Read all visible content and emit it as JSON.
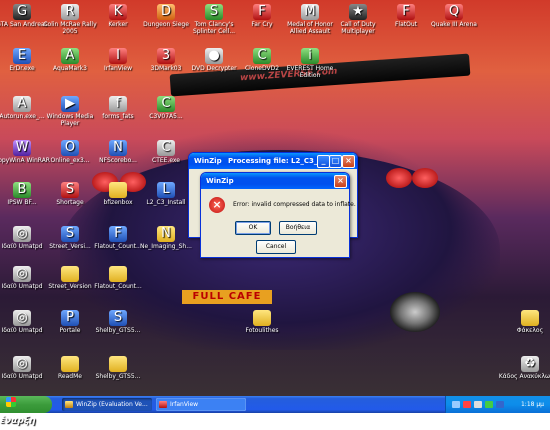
{
  "desktop": {
    "watermark": "www.ZEVERSE.com",
    "plate": "FULL CAFE",
    "icons": [
      {
        "label": "GTA San Andreas",
        "glyph": "G",
        "color": "ic-dark"
      },
      {
        "label": "Colin McRae Rally 2005",
        "glyph": "R",
        "color": "ic-grey"
      },
      {
        "label": "Kerker",
        "glyph": "K",
        "color": "ic-red"
      },
      {
        "label": "Dungeon Siege",
        "glyph": "D",
        "color": "ic-orange"
      },
      {
        "label": "Tom Clancy's Splinter Cell...",
        "glyph": "S",
        "color": "ic-green"
      },
      {
        "label": "Far Cry",
        "glyph": "F",
        "color": "ic-red"
      },
      {
        "label": "Medal of Honor Allied Assault",
        "glyph": "M",
        "color": "ic-grey"
      },
      {
        "label": "Call of Duty Multiplayer",
        "glyph": "★",
        "color": "ic-dark"
      },
      {
        "label": "FlatOut",
        "glyph": "F",
        "color": "ic-red"
      },
      {
        "label": "Quake III Arena",
        "glyph": "Q",
        "color": "ic-red"
      },
      {
        "label": "ErDr.exe",
        "glyph": "E",
        "color": "ic-blue"
      },
      {
        "label": "AquaMark3",
        "glyph": "A",
        "color": "ic-green"
      },
      {
        "label": "IrfanView",
        "glyph": "I",
        "color": "ic-red"
      },
      {
        "label": "3DMark03",
        "glyph": "3",
        "color": "ic-red"
      },
      {
        "label": "DVD Decrypter",
        "glyph": "●",
        "color": "ic-grey"
      },
      {
        "label": "CloneDVD2",
        "glyph": "C",
        "color": "ic-green"
      },
      {
        "label": "EVEREST Home Edition",
        "glyph": "i",
        "color": "ic-green"
      },
      {
        "label": "Autorun.exe_...",
        "glyph": "A",
        "color": "ic-grey"
      },
      {
        "label": "Windows Media Player",
        "glyph": "▶",
        "color": "ic-blue"
      },
      {
        "label": "forms_fats",
        "glyph": "f",
        "color": "ic-grey"
      },
      {
        "label": "C3V07A5...",
        "glyph": "C",
        "color": "ic-green"
      },
      {
        "label": "CopyWinA WinRAR",
        "glyph": "W",
        "color": "ic-purple"
      },
      {
        "label": "Online_ex3...",
        "glyph": "O",
        "color": "ic-blue"
      },
      {
        "label": "NFScorebo...",
        "glyph": "N",
        "color": "ic-blue"
      },
      {
        "label": "CTEE.exe",
        "glyph": "C",
        "color": "ic-grey"
      },
      {
        "label": "IPSW BF...",
        "glyph": "B",
        "color": "ic-green"
      },
      {
        "label": "Shortage",
        "glyph": "S",
        "color": "ic-red"
      },
      {
        "label": "bfizenbox",
        "glyph": "",
        "color": "ic-folder"
      },
      {
        "label": "L2_C3_Install",
        "glyph": "L",
        "color": "ic-blue"
      },
      {
        "label": "Ιδαί0 Umatpd",
        "glyph": "◎",
        "color": "ic-grey"
      },
      {
        "label": "Street_Versi...",
        "glyph": "S",
        "color": "ic-blue"
      },
      {
        "label": "Flatout_Count...",
        "glyph": "F",
        "color": "ic-blue"
      },
      {
        "label": "Ne_Imaging_Sh...",
        "glyph": "N",
        "color": "ic-folder"
      },
      {
        "label": "Ιδαί0 Umatpd",
        "glyph": "◎",
        "color": "ic-grey"
      },
      {
        "label": "Street_Version",
        "glyph": "",
        "color": "ic-folder"
      },
      {
        "label": "Flatout_Count...",
        "glyph": "",
        "color": "ic-folder"
      },
      {
        "label": "Ιδαί0 Umatpd",
        "glyph": "◎",
        "color": "ic-grey"
      },
      {
        "label": "Portale",
        "glyph": "P",
        "color": "ic-blue"
      },
      {
        "label": "Shelby_GTS5...",
        "glyph": "S",
        "color": "ic-blue"
      },
      {
        "label": "Fotoulithes",
        "glyph": "",
        "color": "ic-folder"
      },
      {
        "label": "Φάκελος",
        "glyph": "",
        "color": "ic-folder"
      },
      {
        "label": "Ιδαί0 Umatpd",
        "glyph": "◎",
        "color": "ic-grey"
      },
      {
        "label": "ReadMe",
        "glyph": "",
        "color": "ic-folder"
      },
      {
        "label": "Shelby_GTS5...",
        "glyph": "",
        "color": "ic-folder"
      },
      {
        "label": "Κάδος Ανακύκλωσης",
        "glyph": "♻",
        "color": "ic-grey"
      }
    ]
  },
  "processing_window": {
    "title": "WinZip",
    "title_detail": "Processing file: L2_C3_Ins..."
  },
  "error_dialog": {
    "title": "WinZip",
    "message": "Error: invalid compressed data to inflate.",
    "ok_label": "OK",
    "help_label": "Βοήθεια",
    "cancel_label": "Cancel"
  },
  "taskbar": {
    "start_label": "έναρξη",
    "tasks": [
      {
        "label": "WinZip (Evaluation Ve...",
        "active": true
      },
      {
        "label": "IrfanView",
        "active": false
      }
    ],
    "clock": "1:18 μμ"
  }
}
